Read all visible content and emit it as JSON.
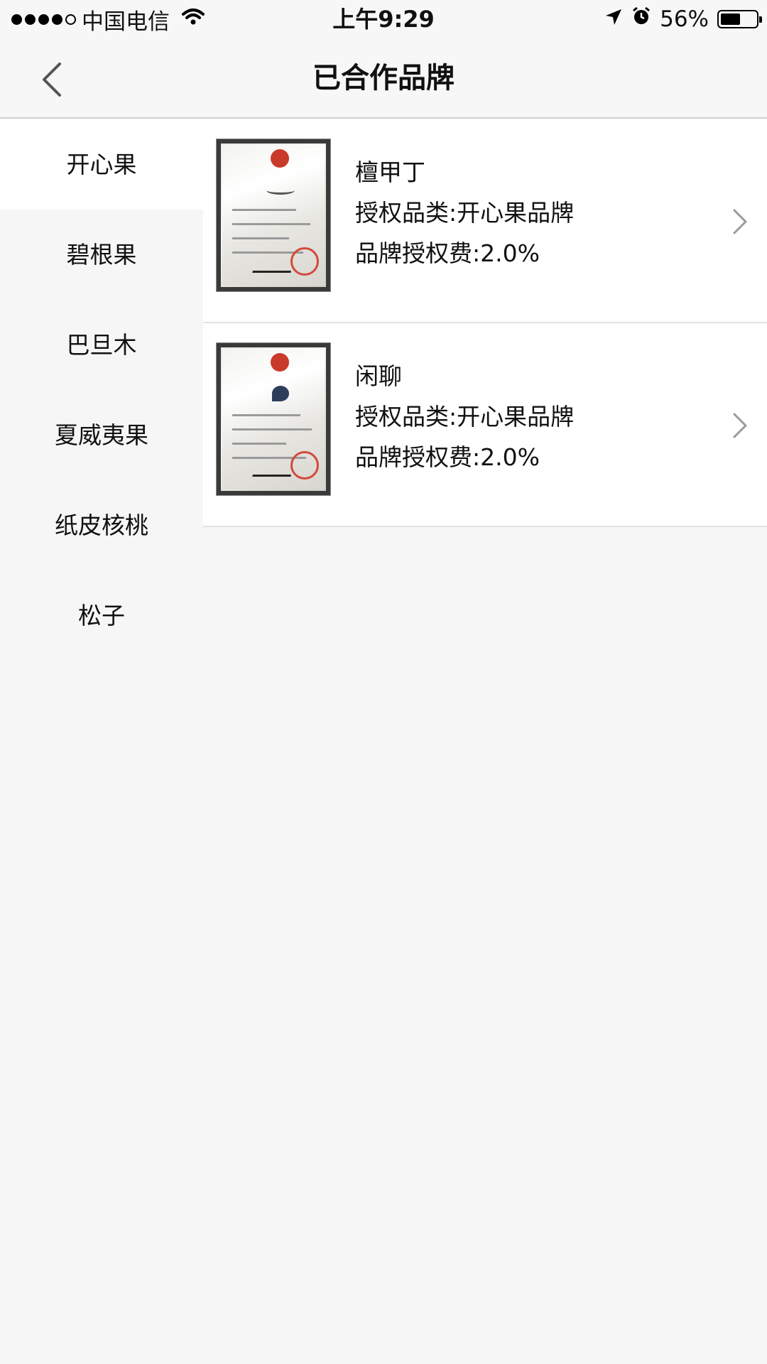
{
  "status_bar": {
    "carrier": "中国电信",
    "time": "上午9:29",
    "battery_text": "56%",
    "battery_level": 0.56,
    "icons": [
      "signal-dots",
      "wifi-icon",
      "location-icon",
      "alarm-icon",
      "battery-icon"
    ]
  },
  "nav": {
    "title": "已合作品牌",
    "back_icon": "chevron-left-icon"
  },
  "sidebar": {
    "items": [
      {
        "label": "开心果",
        "active": true
      },
      {
        "label": "碧根果",
        "active": false
      },
      {
        "label": "巴旦木",
        "active": false
      },
      {
        "label": "夏威夷果",
        "active": false
      },
      {
        "label": "纸皮核桃",
        "active": false
      },
      {
        "label": "松子",
        "active": false
      }
    ]
  },
  "brands": [
    {
      "name": "檀甲丁",
      "category": "授权品类:开心果品牌",
      "fee": "品牌授权费:2.0%",
      "thumb_icon": "trademark-certificate-image"
    },
    {
      "name": "闲聊",
      "category": "授权品类:开心果品牌",
      "fee": "品牌授权费:2.0%",
      "thumb_icon": "trademark-certificate-image"
    }
  ],
  "colors": {
    "background": "#f6f6f6",
    "card": "#ffffff",
    "chevron": "#9a9a9a",
    "seal": "#d24a3c"
  }
}
